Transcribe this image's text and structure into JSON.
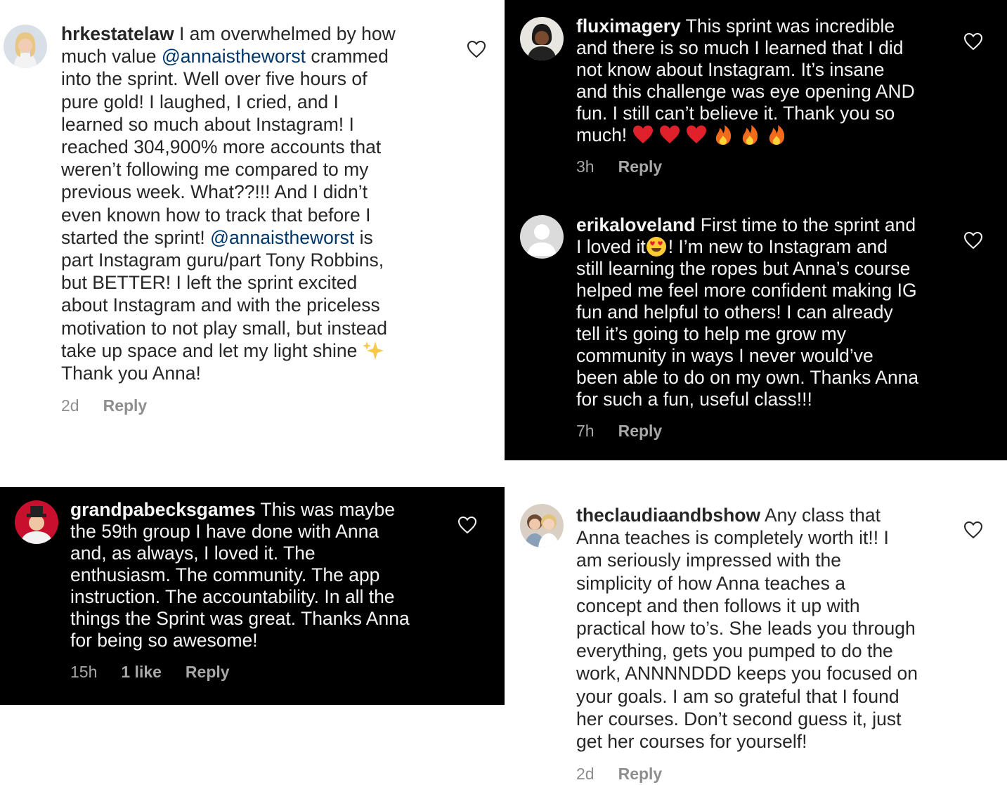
{
  "comments": [
    {
      "username": "hrkestatelaw",
      "text_1": "I am overwhelmed by how",
      "text_2a": "much value",
      "mention_1": "@annaistheworst",
      "text_2b": "crammed",
      "lines_mid": [
        "into the sprint.  Well over five hours of",
        "pure gold!  I laughed, I cried, and I",
        "learned so much about Instagram!  I",
        "reached 304,900% more accounts that",
        "weren’t following me compared to my",
        "previous week.  What??!!! And I didn’t",
        "even known how to track that before I"
      ],
      "text_10a": "started the sprint!",
      "mention_2": "@annaistheworst",
      "text_10b": "is",
      "lines_end": [
        "part Instagram guru/part Tony Robbins,",
        "but BETTER! I left the sprint excited",
        "about Instagram and with the priceless",
        "motivation to not play small, but instead"
      ],
      "text_15": "take up space and let my light shine",
      "text_16": "Thank you Anna!",
      "time": "2d",
      "reply": "Reply"
    },
    {
      "username": "fluximagery",
      "text_1": "This sprint was incredible",
      "lines": [
        "and there is so much I learned that I did",
        "not know about Instagram. It’s insane",
        "and this challenge was eye opening AND",
        "fun. I still can’t believe it. Thank you so"
      ],
      "text_last": "much!",
      "emoji": [
        "red-heart",
        "red-heart",
        "red-heart",
        "fire",
        "fire",
        "fire"
      ],
      "time": "3h",
      "reply": "Reply"
    },
    {
      "username": "erikaloveland",
      "text_1": "First time to the sprint and",
      "text_2a": "I loved it",
      "text_2b": "! I’m new to Instagram and",
      "lines": [
        "still learning the ropes but Anna’s course",
        "helped me feel more confident making IG",
        "fun and helpful to others! I can already",
        "tell it’s going to help me grow my",
        "community in ways I never would’ve",
        "been able to do on my own. Thanks Anna",
        "for such a fun, useful class!!!"
      ],
      "time": "7h",
      "reply": "Reply"
    },
    {
      "username": "grandpabecksgames",
      "text_1": "This was maybe",
      "lines": [
        "the 59th group I have done with Anna",
        "and, as always, I loved it. The",
        "enthusiasm. The community. The app",
        "instruction. The accountability. In all the",
        "things the Sprint was great. Thanks Anna",
        "for being so awesome!"
      ],
      "time": "15h",
      "likes": "1 like",
      "reply": "Reply"
    },
    {
      "username": "theclaudiaandbshow",
      "text_1": "Any class that",
      "lines": [
        "Anna teaches is completely worth it!! I",
        "am seriously impressed with the",
        "simplicity of how Anna teaches a",
        "concept and then follows it up with",
        "practical how to’s. She leads you through",
        "everything, gets you pumped to do the",
        "work, ANNNNDDD keeps you focused on",
        "your goals. I am so grateful that I found",
        "her courses. Don’t second guess it, just",
        "get her courses for yourself!"
      ],
      "time": "2d",
      "reply": "Reply"
    }
  ],
  "colors": {
    "mention": "#00376b",
    "dark_bg": "#000000",
    "light_bg": "#ffffff"
  }
}
